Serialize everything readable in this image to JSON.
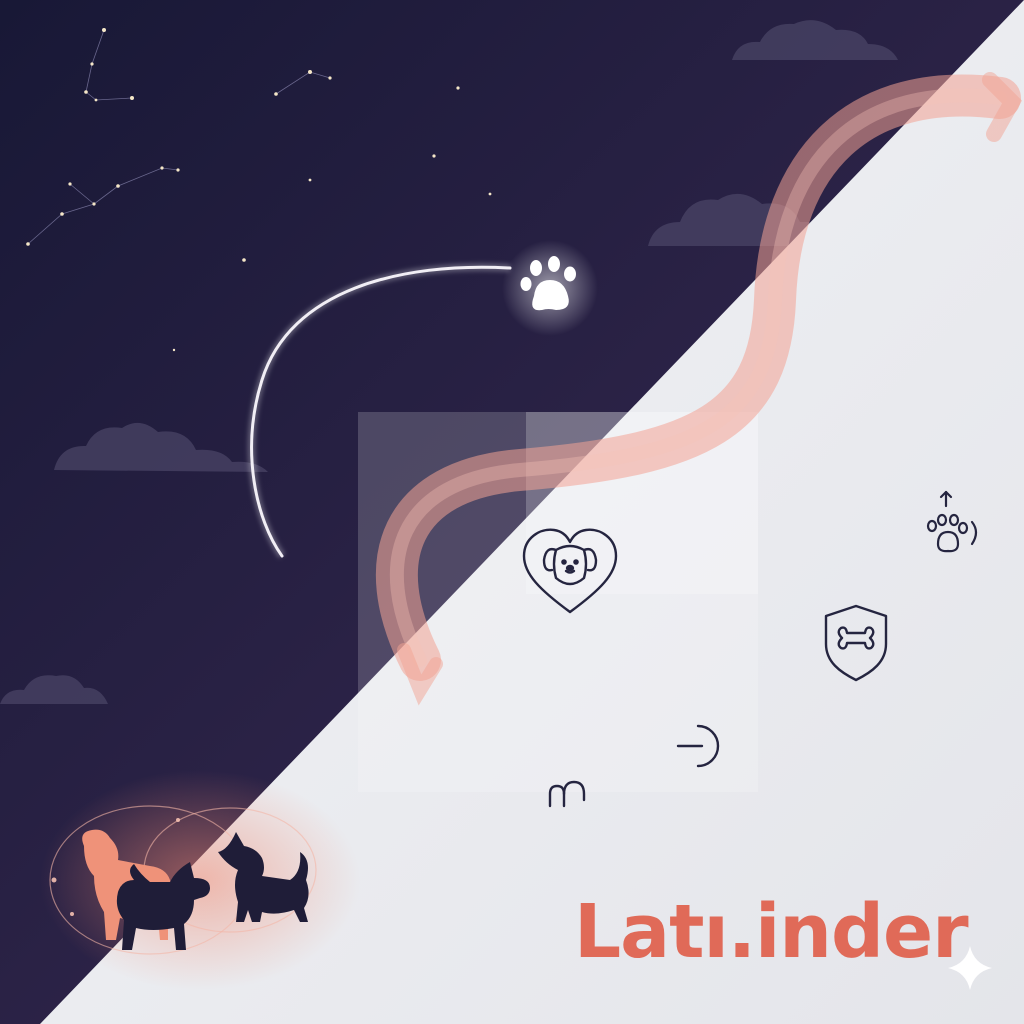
{
  "brand": {
    "wordmark": "Latı.inder"
  },
  "colors": {
    "night_top": "#1b1b3a",
    "night_bottom": "#4a2f4f",
    "day": "#ebecf0",
    "coral": "#e06a58",
    "ribbon": "#f2a394",
    "icon_line": "#252540",
    "silhouette_dark": "#1f1d38",
    "silhouette_coral": "#ee8f78"
  },
  "icons": [
    "paw-icon",
    "heart-dog-icon",
    "paw-up-icon",
    "shield-bone-icon",
    "toggle-arc-icon",
    "m-glyph-icon",
    "sparkle-icon"
  ]
}
